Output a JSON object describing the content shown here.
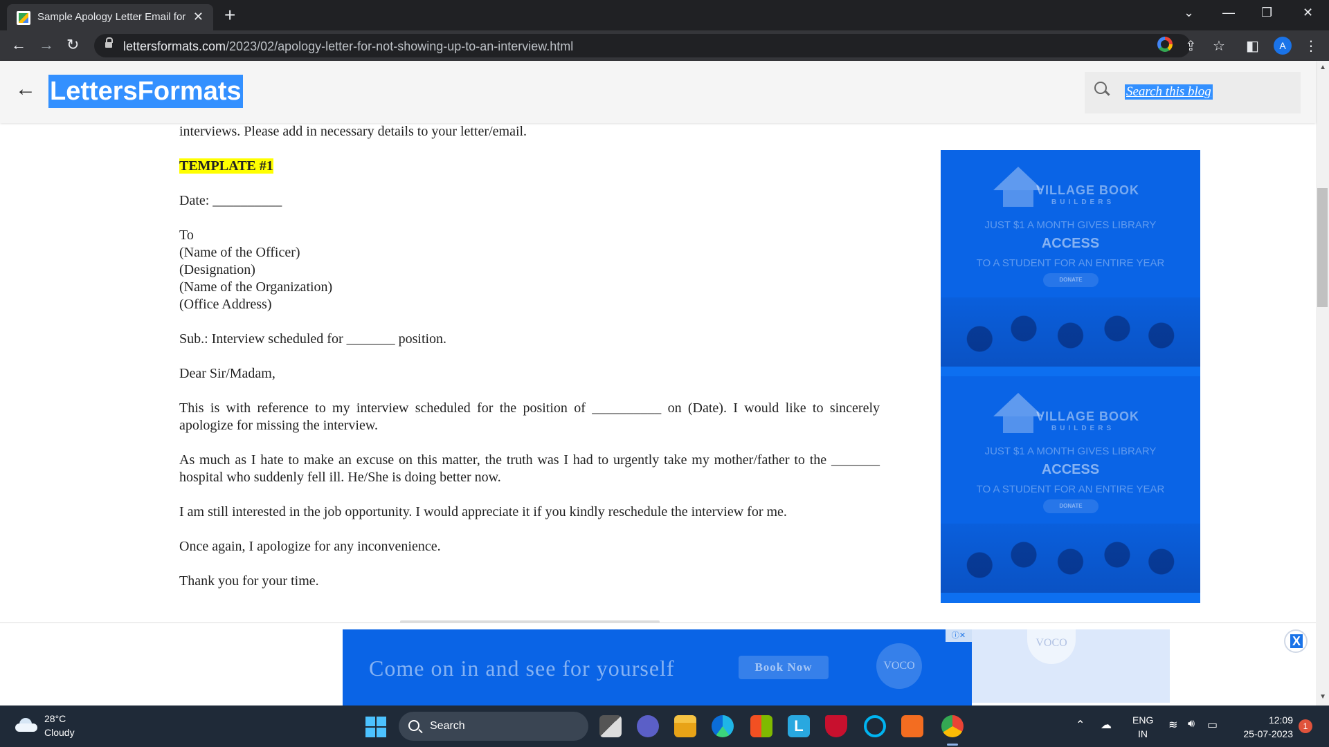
{
  "browser": {
    "tab_title": "Sample Apology Letter Email for",
    "url_host": "lettersformats.com",
    "url_path": "/2023/02/apology-letter-for-not-showing-up-to-an-interview.html",
    "profile_initial": "A"
  },
  "blog": {
    "title": "LettersFormats",
    "search_placeholder": "Search this blog"
  },
  "article": {
    "intro": "interviews. Please add in necessary details to your letter/email.",
    "template_label": "TEMPLATE #1",
    "date_line": "Date: __________",
    "to": "To",
    "officer": "(Name of the Officer)",
    "designation": "(Designation)",
    "organization": "(Name of the Organization)",
    "address": "(Office Address)",
    "subject": "Sub.: Interview scheduled for _______ position.",
    "salutation": "Dear Sir/Madam,",
    "para1": "This is with reference to my interview scheduled for the position of __________ on (Date). I would like to sincerely apologize for missing the interview.",
    "para2": "As much as I hate to make an excuse on this matter, the truth was I had to urgently take my mother/father to the _______ hospital who suddenly fell ill. He/She is doing better now.",
    "para3": "I am still interested in the job opportunity. I would appreciate it if you kindly reschedule the interview for me.",
    "para4": "Once again, I apologize for any inconvenience.",
    "para5": "Thank you for your time."
  },
  "side_ad": {
    "brand": "VILLAGE BOOK",
    "brand_sub": "BUILDERS",
    "line1": "JUST $1 A MONTH GIVES LIBRARY",
    "line2": "ACCESS",
    "line3": "TO A STUDENT FOR AN ENTIRE YEAR",
    "cta": "DONATE"
  },
  "bottom_ad": {
    "headline": "Come on in and see for yourself",
    "cta": "Book Now",
    "logo": "VOCO",
    "close": "X"
  },
  "taskbar": {
    "temperature": "28°C",
    "condition": "Cloudy",
    "search_label": "Search",
    "lang_line1": "ENG",
    "lang_line2": "IN",
    "time": "12:09",
    "date": "25-07-2023",
    "notifications": "1"
  },
  "colors": {
    "selection_blue": "#3390ff",
    "ad_blue": "#0a64e6",
    "highlight_yellow": "#ffff00"
  }
}
